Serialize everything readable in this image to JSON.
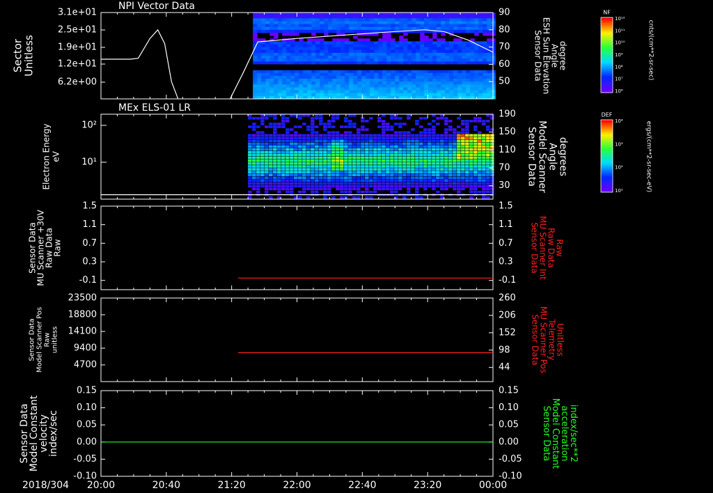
{
  "date_label": "2018/304",
  "time_axis": {
    "range": [
      "20:00",
      "00:00"
    ],
    "ticks": [
      "20:00",
      "20:40",
      "21:20",
      "22:00",
      "22:40",
      "23:20",
      "00:00"
    ],
    "tick_hours": [
      20,
      20.6667,
      21.3333,
      22,
      22.6667,
      23.3333,
      24
    ]
  },
  "colors": {
    "background": "#000000",
    "foreground": "#ffffff",
    "red_trace": "#ff2020",
    "green_trace": "#20ff20"
  },
  "chart_data": [
    {
      "type": "heatmap",
      "title": "NPI Vector Data",
      "ylabel": [
        "Sector",
        "Unitless"
      ],
      "yticks": [
        "3.1e+01",
        "2.5e+01",
        "1.9e+01",
        "1.2e+01",
        "6.2e+00"
      ],
      "yticks_right": [
        "90",
        "80",
        "70",
        "60",
        "50"
      ],
      "ylabel_right": [
        "Sensor Data",
        "ESH Sun Elevation",
        "Angle",
        "degree"
      ],
      "ylim_right": [
        40,
        90
      ],
      "heatmap_start_hour": 21.55,
      "line_series": {
        "name": "ESH Sun Elevation Angle",
        "x_hours": [
          20,
          20.3,
          20.38,
          20.5,
          20.58,
          20.65,
          20.72,
          20.8,
          21.3,
          21.45,
          21.6,
          22,
          22.5,
          23,
          23.3,
          23.5,
          23.75,
          24
        ],
        "y_degrees": [
          63,
          63,
          63.5,
          75,
          80,
          72,
          50,
          38,
          38,
          55,
          73,
          75,
          77,
          79,
          80,
          79,
          74,
          67
        ]
      },
      "colorbar": {
        "label": "NF",
        "units": "cnts/(cm**2-sr-sec)",
        "ticks": [
          "10¹²",
          "10¹¹",
          "10¹⁰",
          "10⁹",
          "10⁸",
          "10⁷",
          "10⁶"
        ]
      }
    },
    {
      "type": "heatmap",
      "title": "MEx ELS-01 LR",
      "ylabel": [
        "Electron Energy",
        "eV"
      ],
      "yticks": [
        "10²",
        "10¹"
      ],
      "yticks_right": [
        "190",
        "150",
        "110",
        "70",
        "30"
      ],
      "ylabel_right": [
        "Sensor Data",
        "Model Scanner",
        "Angle",
        "degrees"
      ],
      "ylim_right": [
        0,
        190
      ],
      "heatmap_start_hour": 21.5,
      "line_series": {
        "name": "Model Scanner Angle",
        "x_hours": [
          20,
          24
        ],
        "y_degrees": [
          10,
          10
        ]
      },
      "colorbar": {
        "label": "DEF",
        "units": "ergs/(cm**2-sr-sec-eV)",
        "ticks": [
          "10⁴",
          "10³",
          "10²",
          "10¹"
        ]
      }
    },
    {
      "type": "line",
      "ylabel": [
        "Sensor Data",
        "MU Scanner +30V",
        "Raw Data",
        "Raw"
      ],
      "yticks": [
        "1.5",
        "1.1",
        "0.7",
        "0.3",
        "-0.1"
      ],
      "yticks_right": [
        "1.5",
        "1.1",
        "0.7",
        "0.3",
        "-0.1"
      ],
      "ylim": [
        -0.3,
        1.5
      ],
      "ylabel_right": [
        "Sensor Data",
        "MU Scanner Int",
        "Raw Data",
        "Raw"
      ],
      "series": [
        {
          "name": "MU Scanner Int",
          "x_hours": [
            21.4,
            24
          ],
          "y": [
            -0.05,
            -0.05
          ],
          "color": "#ff2020",
          "axis": "right"
        }
      ]
    },
    {
      "type": "line",
      "ylabel": [
        "Sensor Data",
        "Model Scanner Pos",
        "Raw",
        "unitless"
      ],
      "yticks": [
        "23500",
        "18800",
        "14100",
        "9400",
        "4700"
      ],
      "ylim": [
        0,
        23500
      ],
      "yticks_right": [
        "260",
        "206",
        "152",
        "98",
        "44"
      ],
      "ylim_right": [
        0,
        260
      ],
      "ylabel_right": [
        "Sensor Data",
        "MU Scanner Pos",
        "Telemetry",
        "Unitless"
      ],
      "series": [
        {
          "name": "MU Scanner Pos",
          "x_hours": [
            21.4,
            24
          ],
          "y": [
            90,
            90
          ],
          "color": "#ff2020",
          "axis": "right"
        }
      ]
    },
    {
      "type": "line",
      "ylabel": [
        "Sensor Data",
        "Model Constant",
        "velocity",
        "index/sec"
      ],
      "yticks": [
        "0.15",
        "0.10",
        "0.05",
        "0.00",
        "-0.05",
        "-0.10"
      ],
      "ylim": [
        -0.1,
        0.15
      ],
      "yticks_right": [
        "0.15",
        "0.10",
        "0.05",
        "0.00",
        "-0.05",
        "-0.10"
      ],
      "ylabel_right": [
        "Sensor Data",
        "Model Constant",
        "acceleration",
        "index/sec**2"
      ],
      "series": [
        {
          "name": "Model Constant acceleration",
          "x_hours": [
            20,
            24
          ],
          "y": [
            0,
            0
          ],
          "color": "#20ff20",
          "axis": "left"
        }
      ]
    }
  ]
}
